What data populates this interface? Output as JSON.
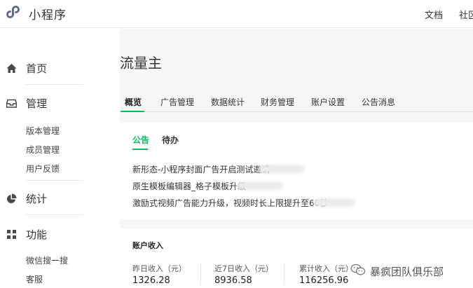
{
  "header": {
    "app_name": "小程序",
    "links": [
      "文档",
      "社区"
    ]
  },
  "sidebar": {
    "groups": [
      {
        "label": "首页",
        "icon": "home-icon"
      },
      {
        "label": "管理",
        "icon": "inbox-icon",
        "items": [
          "版本管理",
          "成员管理",
          "用户反馈"
        ]
      },
      {
        "label": "统计",
        "icon": "pie-chart-icon"
      },
      {
        "label": "功能",
        "icon": "grid-icon",
        "items": [
          "微信搜一搜",
          "客服"
        ]
      }
    ]
  },
  "main": {
    "title": "流量主",
    "tabs": [
      "概览",
      "广告管理",
      "数据统计",
      "财务管理",
      "账户设置",
      "公告消息"
    ],
    "active_tab": "概览",
    "notice_card": {
      "subtabs": [
        "公告",
        "待办"
      ],
      "notices": [
        "新形态-小程序封面广告开启测试邀请",
        "原生模板编辑器_格子模板升级",
        "激励式视频广告能力升级，视频时长上限提升至60秒"
      ]
    },
    "income_card": {
      "title": "账户收入",
      "stats": [
        {
          "label": "昨日收入（元）",
          "value": "1326.28"
        },
        {
          "label": "近7日收入（元）",
          "value": "8936.58"
        },
        {
          "label": "累计收入（元）",
          "value": "116256.96"
        }
      ]
    }
  },
  "watermark": {
    "text": "暴疯团队俱乐部"
  },
  "colors": {
    "accent": "#07c160",
    "logo": "#576b95"
  }
}
